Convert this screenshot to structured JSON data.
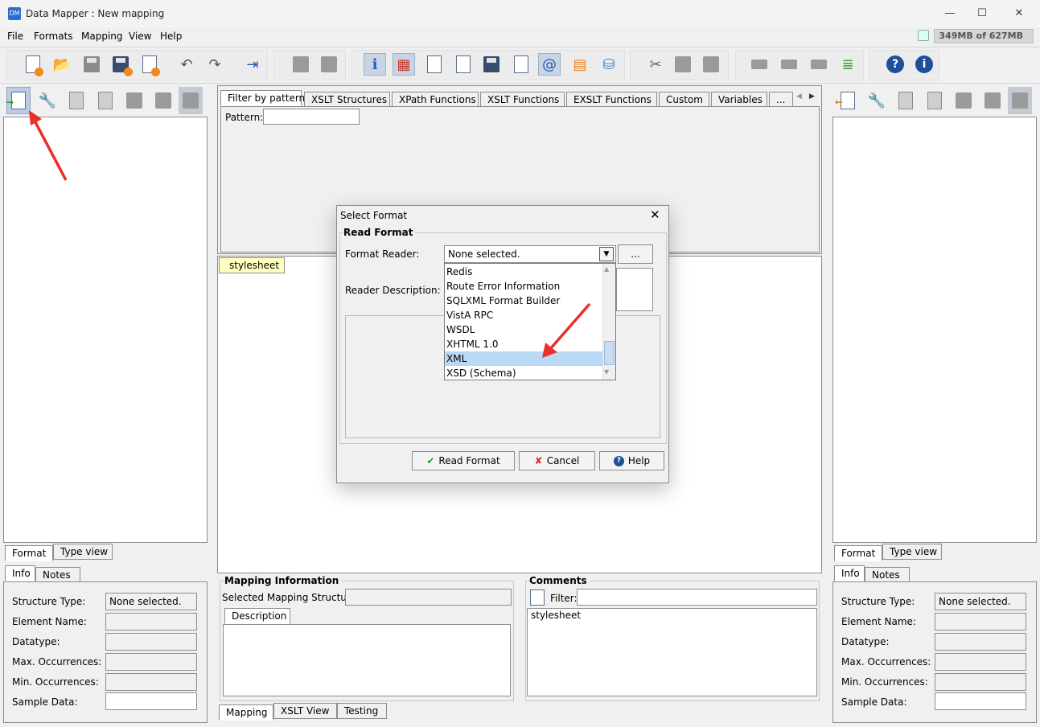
{
  "window": {
    "title": "Data Mapper : New mapping",
    "minimize": "—",
    "maximize": "☐",
    "close": "✕"
  },
  "menu": {
    "file": "File",
    "formats": "Formats",
    "mapping": "Mapping",
    "view": "View",
    "help": "Help"
  },
  "memory": "349MB of 627MB",
  "filter_tabs": [
    "Filter by pattern",
    "XSLT Structures",
    "XPath Functions",
    "XSLT Functions",
    "EXSLT Functions",
    "Custom",
    "Variables",
    "..."
  ],
  "pattern_label": "Pattern:",
  "stylesheet_tag": "stylesheet",
  "left_panel": {
    "view_tabs": [
      "Format",
      "Type view"
    ],
    "info_tabs": [
      "Info",
      "Notes"
    ]
  },
  "right_panel": {
    "view_tabs": [
      "Format",
      "Type view"
    ],
    "info_tabs": [
      "Info",
      "Notes"
    ]
  },
  "info_fields": {
    "structure_type": "Structure Type:",
    "structure_type_value": "None selected.",
    "element_name": "Element Name:",
    "datatype": "Datatype:",
    "max_occ": "Max. Occurrences:",
    "min_occ": "Min. Occurrences:",
    "sample_data": "Sample Data:"
  },
  "mapping_info": {
    "title": "Mapping Information",
    "selected_label": "Selected Mapping Structure:",
    "description_tab": "Description"
  },
  "comments": {
    "title": "Comments",
    "filter_label": "Filter:",
    "text": "stylesheet"
  },
  "bottom_tabs": [
    "Mapping",
    "XSLT View",
    "Testing"
  ],
  "dialog": {
    "title": "Select Format",
    "group": "Read Format",
    "reader_label": "Format Reader:",
    "reader_value": "None selected.",
    "browse_label": "...",
    "description_label": "Reader Description:",
    "options": [
      "Redis",
      "Route Error Information",
      "SQLXML Format Builder",
      "VistA RPC",
      "WSDL",
      "XHTML 1.0",
      "XML",
      "XSD (Schema)"
    ],
    "highlighted": "XML",
    "read_button": "Read Format",
    "cancel_button": "Cancel",
    "help_button": "Help"
  },
  "colors": {
    "accent_arrow": "#e8312a",
    "highlight": "#b8d8f6",
    "stylesheet_bg": "#ffffc0"
  }
}
